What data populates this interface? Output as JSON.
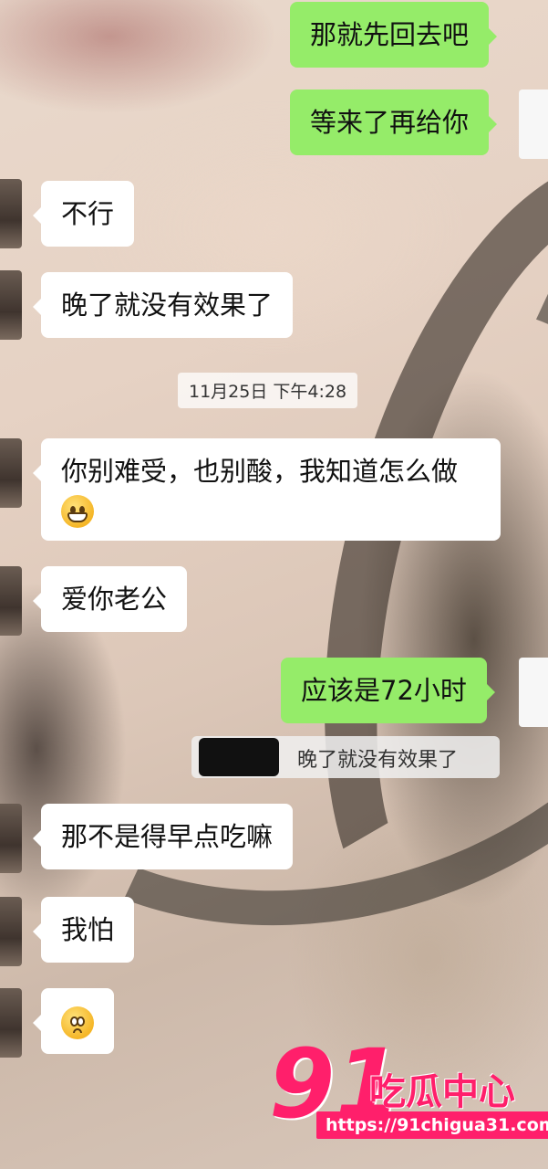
{
  "conversation": {
    "messages": [
      {
        "side": "out",
        "text": "那就先回去吧"
      },
      {
        "side": "out",
        "text": "等来了再给你"
      },
      {
        "side": "in",
        "text": "不行"
      },
      {
        "side": "in",
        "text": "晚了就没有效果了"
      },
      {
        "side": "in",
        "text_line1": "你别难受，也别酸，我知道怎么做",
        "emoji": "grinning-emoji"
      },
      {
        "side": "in",
        "text": "爱你老公"
      },
      {
        "side": "out",
        "text": "应该是72小时",
        "quote": "晚了就没有效果了"
      },
      {
        "side": "in",
        "text": "那不是得早点吃嘛"
      },
      {
        "side": "in",
        "text": "我怕"
      },
      {
        "side": "in",
        "emoji": "worried-face-emoji"
      }
    ],
    "timestamp": "11月25日 下午4:28"
  },
  "watermark": {
    "number": "91",
    "name": "吃瓜中心",
    "url": "https://91chigua31.com"
  },
  "colors": {
    "outgoing_bubble": "#95ec69",
    "incoming_bubble": "#ffffff",
    "watermark": "#ff1f6b"
  }
}
